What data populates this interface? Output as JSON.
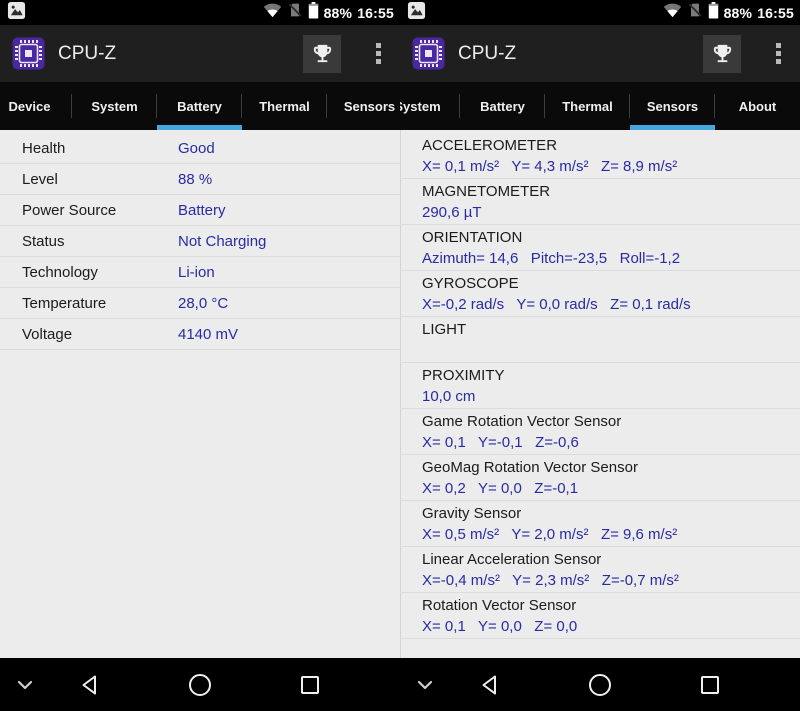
{
  "status_bar": {
    "battery_percent": "88%",
    "time": "16:55"
  },
  "app_bar": {
    "title": "CPU-Z"
  },
  "colors": {
    "accent_underline": "#45a8dd",
    "value_text": "#2a2aa4",
    "app_icon_bg": "#4a28a0",
    "content_bg": "#ececec"
  },
  "icons": [
    "screenshot-icon",
    "wifi-icon",
    "no-sim-icon",
    "battery-icon",
    "cpu-chip-icon",
    "trophy-icon",
    "overflow-menu-icon",
    "chevron-down-icon",
    "back-icon",
    "home-icon",
    "recents-icon"
  ],
  "screens": [
    {
      "name": "battery-screen",
      "tabs": [
        "Device",
        "System",
        "Battery",
        "Thermal",
        "Sensors"
      ],
      "active_tab": "Battery",
      "rows": [
        {
          "label": "Health",
          "value": "Good"
        },
        {
          "label": "Level",
          "value": "88 %"
        },
        {
          "label": "Power Source",
          "value": "Battery"
        },
        {
          "label": "Status",
          "value": "Not Charging"
        },
        {
          "label": "Technology",
          "value": "Li-ion"
        },
        {
          "label": "Temperature",
          "value": "28,0 °C"
        },
        {
          "label": "Voltage",
          "value": "4140 mV"
        }
      ]
    },
    {
      "name": "sensors-screen",
      "tabs": [
        "System",
        "Battery",
        "Thermal",
        "Sensors",
        "About"
      ],
      "active_tab": "Sensors",
      "sections": [
        {
          "name": "ACCELEROMETER",
          "value": "X= 0,1 m/s²   Y= 4,3 m/s²   Z= 8,9 m/s²"
        },
        {
          "name": "MAGNETOMETER",
          "value": "290,6 µT"
        },
        {
          "name": "ORIENTATION",
          "value": "Azimuth= 14,6   Pitch=-23,5   Roll=-1,2"
        },
        {
          "name": "GYROSCOPE",
          "value": "X=-0,2 rad/s   Y= 0,0 rad/s   Z= 0,1 rad/s"
        },
        {
          "name": "LIGHT",
          "value": ""
        },
        {
          "name": "PROXIMITY",
          "value": "10,0 cm"
        },
        {
          "name": "Game Rotation Vector Sensor",
          "value": "X= 0,1   Y=-0,1   Z=-0,6"
        },
        {
          "name": "GeoMag Rotation Vector Sensor",
          "value": "X= 0,2   Y= 0,0   Z=-0,1"
        },
        {
          "name": "Gravity Sensor",
          "value": "X= 0,5 m/s²   Y= 2,0 m/s²   Z= 9,6 m/s²"
        },
        {
          "name": "Linear Acceleration Sensor",
          "value": "X=-0,4 m/s²   Y= 2,3 m/s²   Z=-0,7 m/s²"
        },
        {
          "name": "Rotation Vector Sensor",
          "value": "X= 0,1   Y= 0,0   Z= 0,0"
        }
      ]
    }
  ]
}
